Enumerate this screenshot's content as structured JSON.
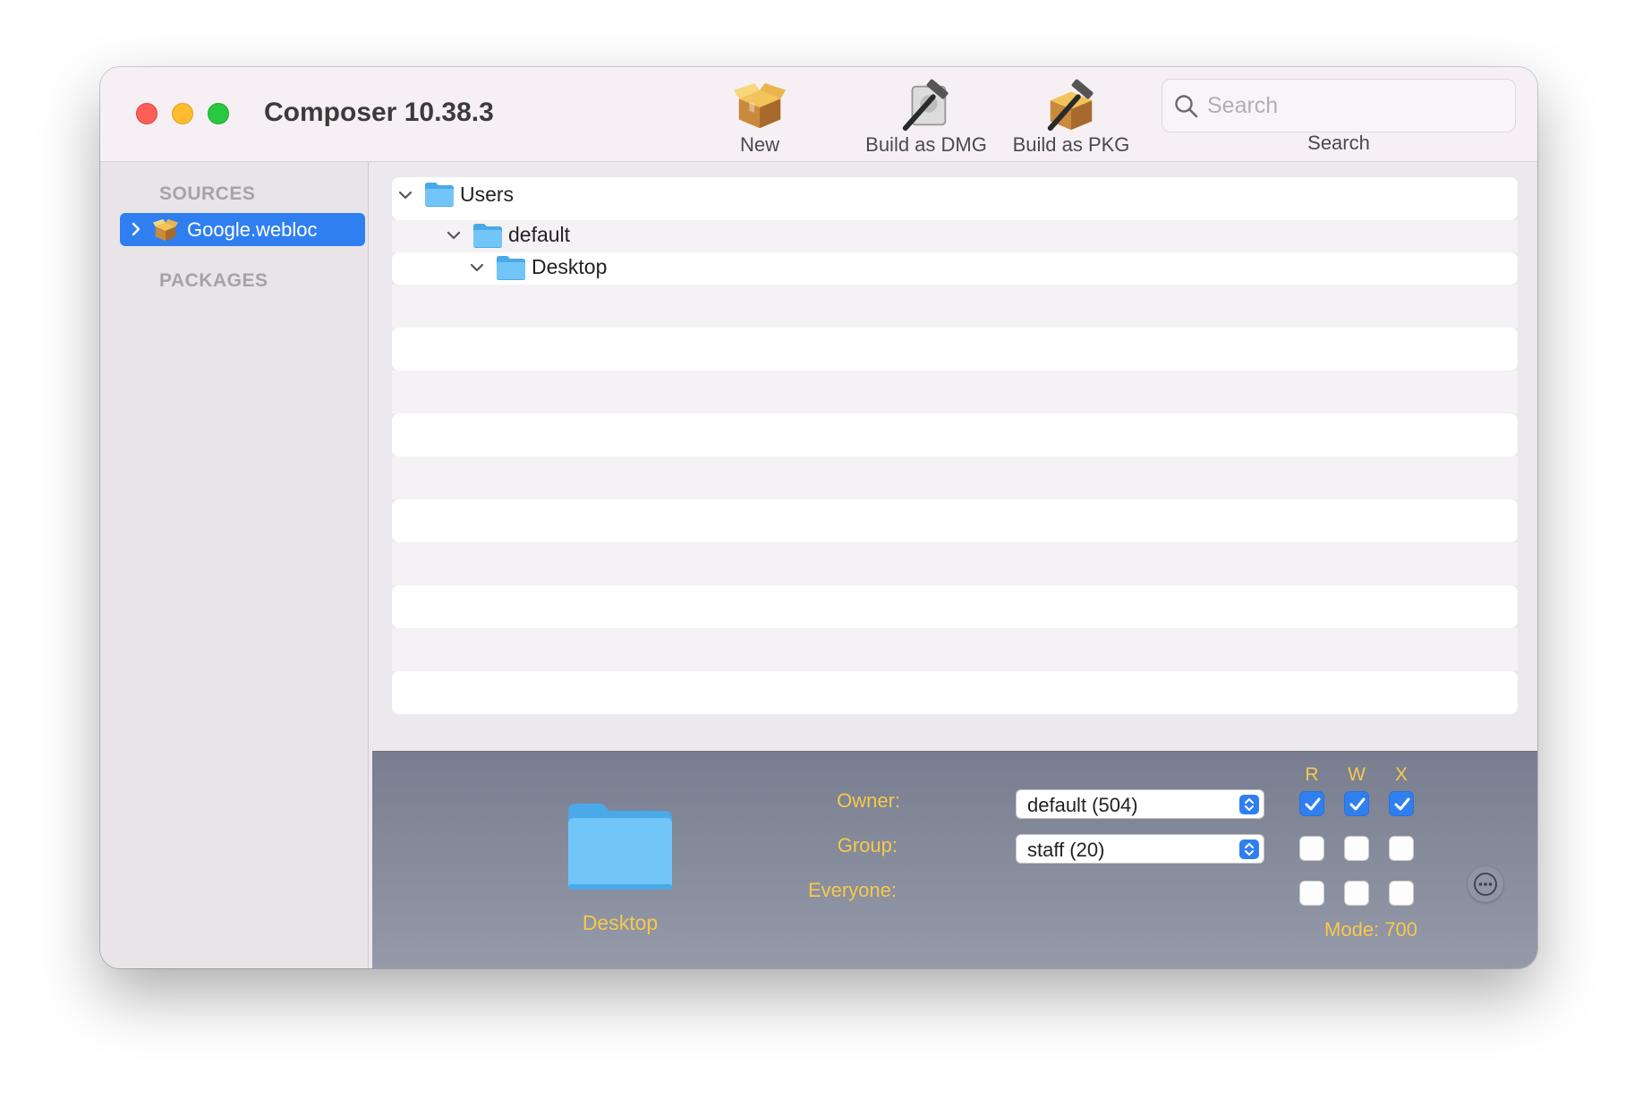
{
  "window": {
    "title": "Composer 10.38.3"
  },
  "toolbar": {
    "new_label": "New",
    "build_dmg_label": "Build as DMG",
    "build_pkg_label": "Build as PKG",
    "search_placeholder": "Search",
    "search_label": "Search"
  },
  "sidebar": {
    "sources_header": "SOURCES",
    "packages_header": "PACKAGES",
    "sources": [
      {
        "label": "Google.webloc",
        "selected": true,
        "icon": "package-icon"
      }
    ]
  },
  "tree": {
    "items": [
      {
        "name": "Users",
        "icon": "folder-icon",
        "expanded": true
      },
      {
        "name": "default",
        "icon": "folder-icon",
        "expanded": true
      },
      {
        "name": "Desktop",
        "icon": "folder-icon",
        "expanded": true
      }
    ]
  },
  "info": {
    "selected_name": "Desktop",
    "owner_label": "Owner:",
    "group_label": "Group:",
    "everyone_label": "Everyone:",
    "owner_value": "default (504)",
    "group_value": "staff (20)",
    "perm_headers": [
      "R",
      "W",
      "X"
    ],
    "permissions": {
      "owner": [
        true,
        true,
        true
      ],
      "group": [
        false,
        false,
        false
      ],
      "everyone": [
        false,
        false,
        false
      ]
    },
    "mode": "Mode: 700"
  },
  "colors": {
    "accent": "#2f7ff0",
    "info_text": "#f7c84c",
    "folder": "#6cc4f5"
  }
}
